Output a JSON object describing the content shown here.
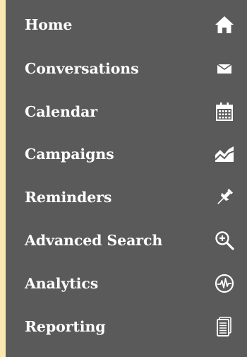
{
  "nav": {
    "items": [
      {
        "label": "Home",
        "icon": "home-icon"
      },
      {
        "label": "Conversations",
        "icon": "envelope-icon"
      },
      {
        "label": "Calendar",
        "icon": "calendar-icon"
      },
      {
        "label": "Campaigns",
        "icon": "area-chart-icon"
      },
      {
        "label": "Reminders",
        "icon": "pushpin-icon"
      },
      {
        "label": "Advanced Search",
        "icon": "zoom-search-icon"
      },
      {
        "label": "Analytics",
        "icon": "pulse-circle-icon"
      },
      {
        "label": "Reporting",
        "icon": "document-stack-icon"
      }
    ]
  },
  "colors": {
    "background": "#fbe7b2",
    "sidebar": "#5a5a5a",
    "text": "#ffffff"
  }
}
